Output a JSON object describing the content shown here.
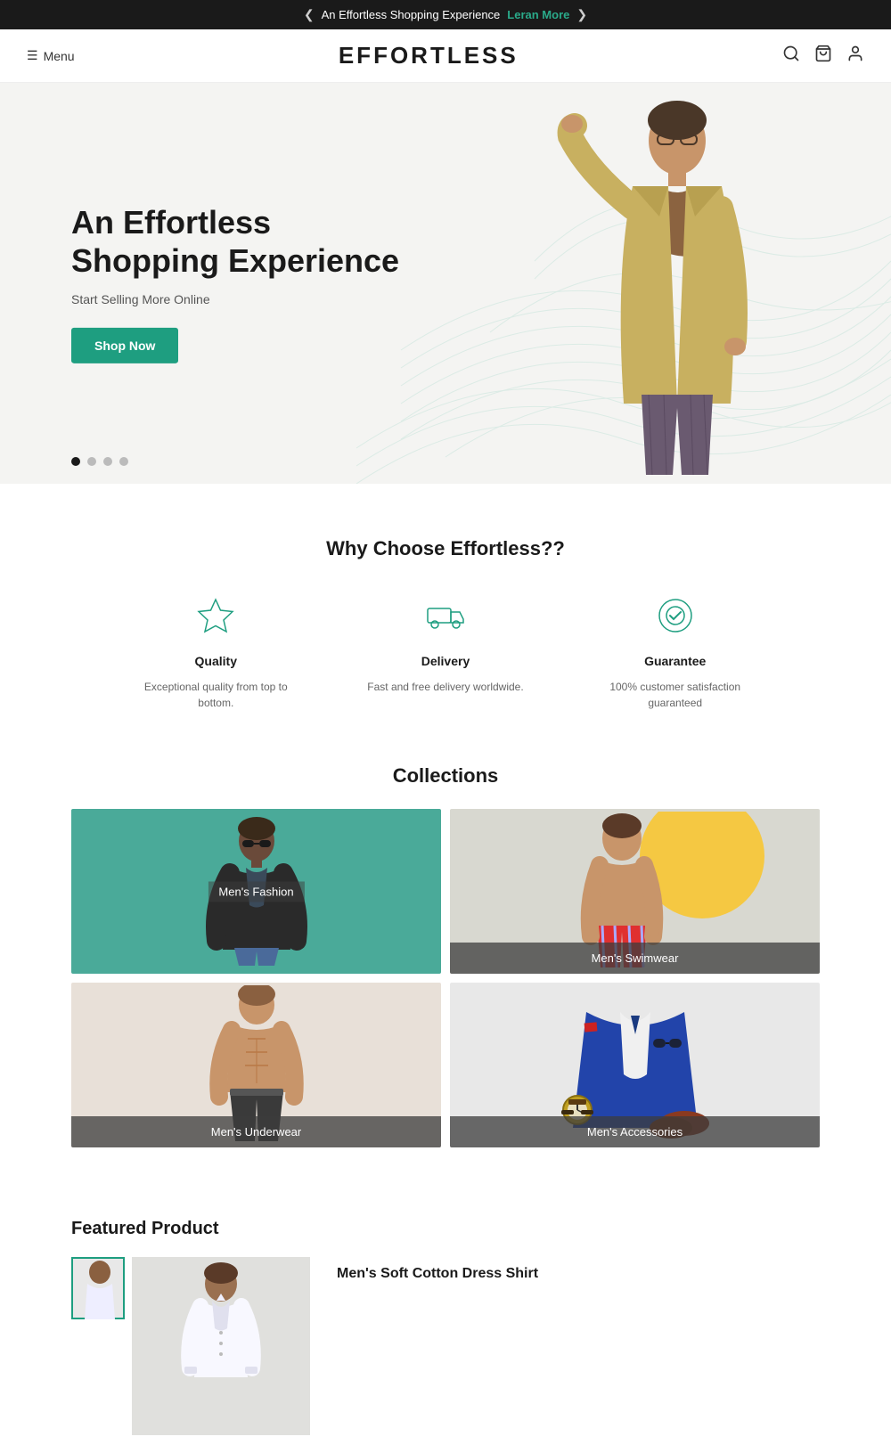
{
  "announcement": {
    "text": "An Effortless Shopping Experience",
    "link_text": "Leran More",
    "prev_arrow": "❮",
    "next_arrow": "❯"
  },
  "header": {
    "menu_label": "Menu",
    "logo": "EFFORTLESS"
  },
  "hero": {
    "title_line1": "An Effortless",
    "title_line2": "Shopping Experience",
    "subtitle": "Start Selling More Online",
    "cta_label": "Shop Now",
    "dots": [
      {
        "active": true
      },
      {
        "active": false
      },
      {
        "active": false
      },
      {
        "active": false
      }
    ]
  },
  "why": {
    "title": "Why Choose Effortless??",
    "features": [
      {
        "icon": "star",
        "title": "Quality",
        "desc": "Exceptional quality from top to bottom."
      },
      {
        "icon": "delivery",
        "title": "Delivery",
        "desc": "Fast and free delivery worldwide."
      },
      {
        "icon": "guarantee",
        "title": "Guarantee",
        "desc": "100% customer satisfaction guaranteed"
      }
    ]
  },
  "collections": {
    "title": "Collections",
    "items": [
      {
        "label": "Men's Fashion",
        "center": true,
        "bg": "teal"
      },
      {
        "label": "Men's Swimwear",
        "center": false,
        "bg": "light-gray"
      },
      {
        "label": "Men's Underwear",
        "center": false,
        "bg": "beige"
      },
      {
        "label": "Men's Accessories",
        "center": false,
        "bg": "white-gray"
      }
    ]
  },
  "featured": {
    "title": "Featured Product",
    "product_name": "Men's Soft Cotton Dress Shirt"
  }
}
